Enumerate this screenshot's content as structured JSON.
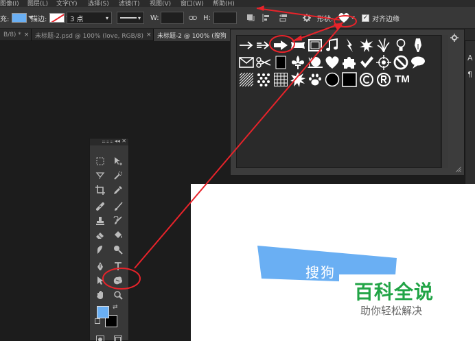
{
  "menu": [
    "图像(I)",
    "图层(L)",
    "文字(Y)",
    "选择(S)",
    "滤镜(T)",
    "视图(V)",
    "窗口(W)",
    "帮助(H)"
  ],
  "options": {
    "fill_label": "充:",
    "fill_color": "#6aaff3",
    "stroke_label": "描边:",
    "stroke_width": "3 点",
    "w_label": "W:",
    "h_label": "H:",
    "shape_label": "形状:",
    "align_edges_label": "对齐边缘",
    "align_edges_checked": "✓"
  },
  "tabs": [
    {
      "label": "B/8) *",
      "close": "×"
    },
    {
      "label": "未标题-2.psd @ 100% (love, RGB/8)",
      "close": "×"
    },
    {
      "label": "未标题-2 @ 100% (搜狗",
      "close": "×"
    }
  ],
  "shape_picker": {
    "icons": [
      "arrow-thin-icon",
      "arrow-hollow-icon",
      "arrow-bold-icon",
      "banner-icon",
      "frame-icon",
      "music-note-icon",
      "lightning-icon",
      "starburst-icon",
      "grass-icon",
      "lightbulb-icon",
      "pen-icon",
      "envelope-icon",
      "scissors-icon",
      "rectangle-icon",
      "fleur-de-lis-icon",
      "snail-icon",
      "heart-icon",
      "puzzle-icon",
      "checkmark-icon",
      "target-icon",
      "no-sign-icon",
      "speech-bubble-icon",
      "hatch-pattern-icon",
      "dots-pattern-icon",
      "grid-pattern-icon",
      "burst-icon",
      "paw-print-icon",
      "circle-icon",
      "square-icon",
      "copyright-icon",
      "registered-icon",
      "trademark-icon"
    ],
    "trademark_text": "TM"
  },
  "right_strip": [
    "A",
    "¶"
  ],
  "canvas": {
    "shape_color": "#6aaff3",
    "shape_text": "搜狗"
  },
  "watermark": {
    "title": "百科全说",
    "subtitle": "助你轻松解决",
    "title_color": "#21a446"
  },
  "toolbox": {
    "fg_color": "#6aaff3",
    "bg_color": "#000000",
    "collapse": "◂◂ ✕"
  },
  "annotation_color": "#e8232a"
}
